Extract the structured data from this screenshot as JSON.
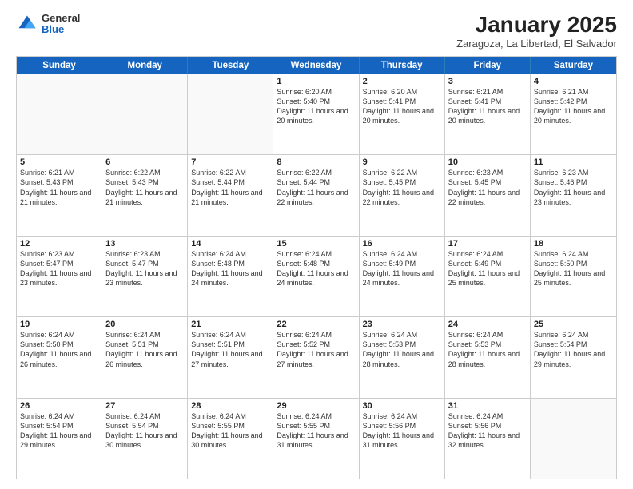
{
  "logo": {
    "general": "General",
    "blue": "Blue"
  },
  "title": {
    "month": "January 2025",
    "location": "Zaragoza, La Libertad, El Salvador"
  },
  "header_days": [
    "Sunday",
    "Monday",
    "Tuesday",
    "Wednesday",
    "Thursday",
    "Friday",
    "Saturday"
  ],
  "weeks": [
    [
      {
        "day": "",
        "info": ""
      },
      {
        "day": "",
        "info": ""
      },
      {
        "day": "",
        "info": ""
      },
      {
        "day": "1",
        "info": "Sunrise: 6:20 AM\nSunset: 5:40 PM\nDaylight: 11 hours and 20 minutes."
      },
      {
        "day": "2",
        "info": "Sunrise: 6:20 AM\nSunset: 5:41 PM\nDaylight: 11 hours and 20 minutes."
      },
      {
        "day": "3",
        "info": "Sunrise: 6:21 AM\nSunset: 5:41 PM\nDaylight: 11 hours and 20 minutes."
      },
      {
        "day": "4",
        "info": "Sunrise: 6:21 AM\nSunset: 5:42 PM\nDaylight: 11 hours and 20 minutes."
      }
    ],
    [
      {
        "day": "5",
        "info": "Sunrise: 6:21 AM\nSunset: 5:43 PM\nDaylight: 11 hours and 21 minutes."
      },
      {
        "day": "6",
        "info": "Sunrise: 6:22 AM\nSunset: 5:43 PM\nDaylight: 11 hours and 21 minutes."
      },
      {
        "day": "7",
        "info": "Sunrise: 6:22 AM\nSunset: 5:44 PM\nDaylight: 11 hours and 21 minutes."
      },
      {
        "day": "8",
        "info": "Sunrise: 6:22 AM\nSunset: 5:44 PM\nDaylight: 11 hours and 22 minutes."
      },
      {
        "day": "9",
        "info": "Sunrise: 6:22 AM\nSunset: 5:45 PM\nDaylight: 11 hours and 22 minutes."
      },
      {
        "day": "10",
        "info": "Sunrise: 6:23 AM\nSunset: 5:45 PM\nDaylight: 11 hours and 22 minutes."
      },
      {
        "day": "11",
        "info": "Sunrise: 6:23 AM\nSunset: 5:46 PM\nDaylight: 11 hours and 23 minutes."
      }
    ],
    [
      {
        "day": "12",
        "info": "Sunrise: 6:23 AM\nSunset: 5:47 PM\nDaylight: 11 hours and 23 minutes."
      },
      {
        "day": "13",
        "info": "Sunrise: 6:23 AM\nSunset: 5:47 PM\nDaylight: 11 hours and 23 minutes."
      },
      {
        "day": "14",
        "info": "Sunrise: 6:24 AM\nSunset: 5:48 PM\nDaylight: 11 hours and 24 minutes."
      },
      {
        "day": "15",
        "info": "Sunrise: 6:24 AM\nSunset: 5:48 PM\nDaylight: 11 hours and 24 minutes."
      },
      {
        "day": "16",
        "info": "Sunrise: 6:24 AM\nSunset: 5:49 PM\nDaylight: 11 hours and 24 minutes."
      },
      {
        "day": "17",
        "info": "Sunrise: 6:24 AM\nSunset: 5:49 PM\nDaylight: 11 hours and 25 minutes."
      },
      {
        "day": "18",
        "info": "Sunrise: 6:24 AM\nSunset: 5:50 PM\nDaylight: 11 hours and 25 minutes."
      }
    ],
    [
      {
        "day": "19",
        "info": "Sunrise: 6:24 AM\nSunset: 5:50 PM\nDaylight: 11 hours and 26 minutes."
      },
      {
        "day": "20",
        "info": "Sunrise: 6:24 AM\nSunset: 5:51 PM\nDaylight: 11 hours and 26 minutes."
      },
      {
        "day": "21",
        "info": "Sunrise: 6:24 AM\nSunset: 5:51 PM\nDaylight: 11 hours and 27 minutes."
      },
      {
        "day": "22",
        "info": "Sunrise: 6:24 AM\nSunset: 5:52 PM\nDaylight: 11 hours and 27 minutes."
      },
      {
        "day": "23",
        "info": "Sunrise: 6:24 AM\nSunset: 5:53 PM\nDaylight: 11 hours and 28 minutes."
      },
      {
        "day": "24",
        "info": "Sunrise: 6:24 AM\nSunset: 5:53 PM\nDaylight: 11 hours and 28 minutes."
      },
      {
        "day": "25",
        "info": "Sunrise: 6:24 AM\nSunset: 5:54 PM\nDaylight: 11 hours and 29 minutes."
      }
    ],
    [
      {
        "day": "26",
        "info": "Sunrise: 6:24 AM\nSunset: 5:54 PM\nDaylight: 11 hours and 29 minutes."
      },
      {
        "day": "27",
        "info": "Sunrise: 6:24 AM\nSunset: 5:54 PM\nDaylight: 11 hours and 30 minutes."
      },
      {
        "day": "28",
        "info": "Sunrise: 6:24 AM\nSunset: 5:55 PM\nDaylight: 11 hours and 30 minutes."
      },
      {
        "day": "29",
        "info": "Sunrise: 6:24 AM\nSunset: 5:55 PM\nDaylight: 11 hours and 31 minutes."
      },
      {
        "day": "30",
        "info": "Sunrise: 6:24 AM\nSunset: 5:56 PM\nDaylight: 11 hours and 31 minutes."
      },
      {
        "day": "31",
        "info": "Sunrise: 6:24 AM\nSunset: 5:56 PM\nDaylight: 11 hours and 32 minutes."
      },
      {
        "day": "",
        "info": ""
      }
    ]
  ]
}
